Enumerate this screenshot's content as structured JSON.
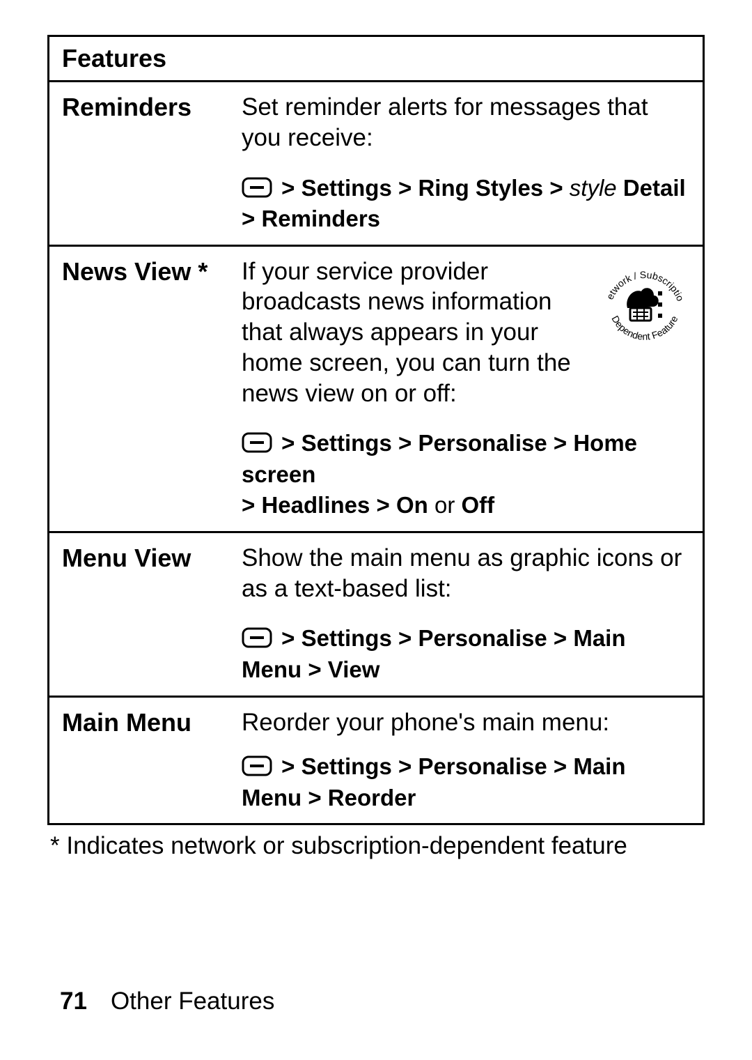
{
  "header": "Features",
  "rows": [
    {
      "name": "Reminders",
      "desc": "Set reminder alerts for messages that you receive:",
      "path_parts": [
        "Settings",
        "Ring Styles"
      ],
      "path_italic": "style",
      "path_parts2": [
        "Detail",
        "Reminders"
      ],
      "has_ns_icon": false
    },
    {
      "name": "News View *",
      "desc": "If your service provider broadcasts news information that always appears in your home screen, you can turn the news view on or off:",
      "path_parts": [
        "Settings",
        "Personalise",
        "Home screen",
        "Headlines"
      ],
      "path_tail_label": "On",
      "path_tail_conj": "or",
      "path_tail_label2": "Off",
      "has_ns_icon": true
    },
    {
      "name": "Menu View",
      "desc": "Show the main menu as graphic icons or as a text-based list:",
      "path_parts": [
        "Settings",
        "Personalise",
        "Main Menu",
        "View"
      ],
      "has_ns_icon": false
    },
    {
      "name": "Main Menu",
      "desc": "Reorder your phone's main menu:",
      "path_parts": [
        "Settings",
        "Personalise",
        "Main Menu",
        "Reorder"
      ],
      "has_ns_icon": false
    }
  ],
  "footnote": "* Indicates network or subscription-dependent feature",
  "footer": {
    "page": "71",
    "section": "Other Features"
  },
  "ns_icon_label_top": "Network / Subscription",
  "ns_icon_label_bottom": "Dependent Feature",
  "gt": ">",
  "gt_sp": " > "
}
